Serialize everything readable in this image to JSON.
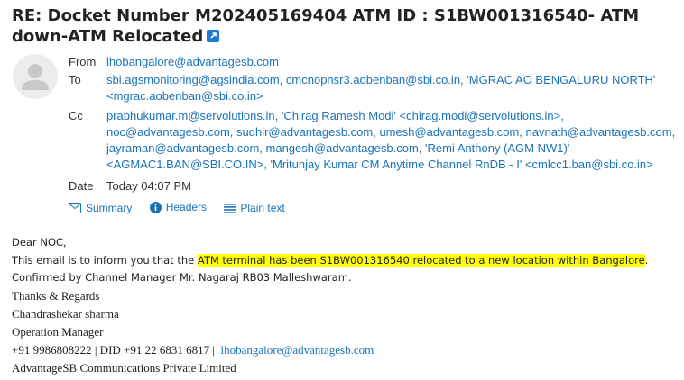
{
  "subject": "RE: Docket Number M202405169404 ATM ID : S1BW001316540- ATM down-ATM Relocated",
  "header": {
    "from_label": "From",
    "from_value": "lhobangalore@advantagesb.com",
    "to_label": "To",
    "to_value": "sbi.agsmonitoring@agsindia.com, cmcnopnsr3.aobenban@sbi.co.in, 'MGRAC AO BENGALURU NORTH' <mgrac.aobenban@sbi.co.in>",
    "cc_label": "Cc",
    "cc_value": "prabhukumar.m@servolutions.in, 'Chirag Ramesh Modi' <chirag.modi@servolutions.in>, noc@advantagesb.com, sudhir@advantagesb.com, umesh@advantagesb.com, navnath@advantagesb.com, jayraman@advantagesb.com, mangesh@advantagesb.com, 'Remi Anthony (AGM NW1)' <AGMAC1.BAN@SBI.CO.IN>, 'Mritunjay Kumar CM Anytime Channel RnDB - I' <cmlcc1.ban@sbi.co.in>",
    "date_label": "Date",
    "date_value": "Today 04:07 PM"
  },
  "actions": {
    "summary": "Summary",
    "headers": "Headers",
    "plain_text": "Plain text"
  },
  "body": {
    "greeting": "Dear NOC,",
    "line1_prefix": "This email is to inform you that the ",
    "line1_highlight": "ATM terminal  has been S1BW001316540 relocated to a new location within Bangalore",
    "line1_suffix": ".",
    "line2": "Confirmed by Channel Manager Mr. Nagaraj RB03 Malleshwaram.",
    "sig_thanks": "Thanks & Regards",
    "sig_name": "Chandrashekar sharma",
    "sig_title": "Operation Manager",
    "sig_phone": "+91 9986808222 | DID +91 22 6831 6817 |",
    "sig_email": "lhobangalore@advantagesb.com",
    "sig_company": "AdvantageSB Communications Private Limited"
  },
  "colors": {
    "link": "#1a73b8",
    "highlight": "#ffff00",
    "accent": "#1f79d1"
  }
}
